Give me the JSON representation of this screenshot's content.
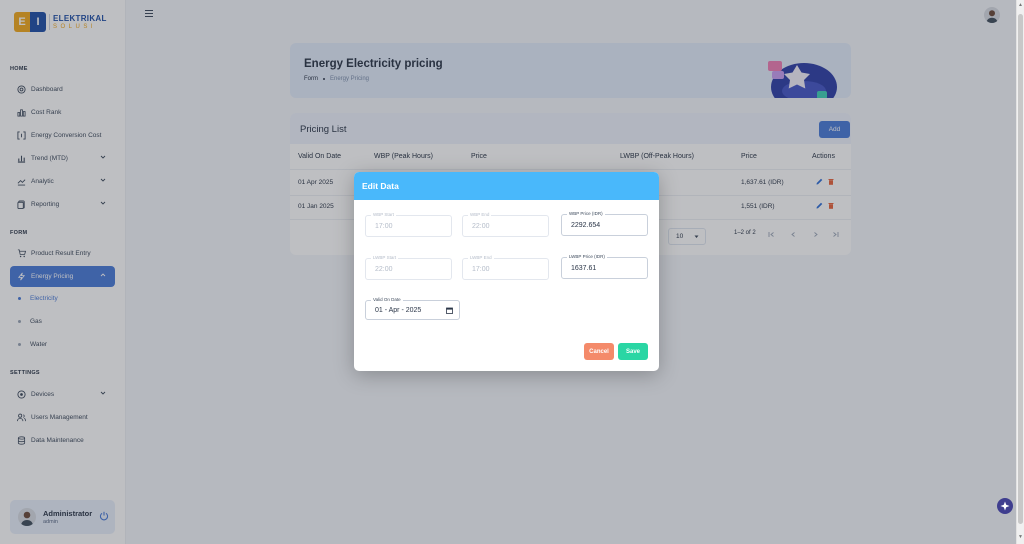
{
  "brand": {
    "line1": "ELEKTRIKAL",
    "line2": "SOLUSI",
    "mark_left": "E",
    "mark_right": "I"
  },
  "sidebar": {
    "sections": {
      "home": "HOME",
      "form": "FORM",
      "settings": "SETTINGS"
    },
    "items": {
      "dashboard": "Dashboard",
      "cost_rank": "Cost Rank",
      "energy_conversion_cost": "Energy Conversion Cost",
      "trend": "Trend (MTD)",
      "analytic": "Analytic",
      "reporting": "Reporting",
      "product_result_entry": "Product Result Entry",
      "energy_pricing": "Energy Pricing",
      "electricity": "Electricity",
      "gas": "Gas",
      "water": "Water",
      "devices": "Devices",
      "users_management": "Users Management",
      "data_maintenance": "Data Maintenance"
    }
  },
  "profile": {
    "name": "Administrator",
    "role": "admin"
  },
  "hero": {
    "title": "Energy Electricity pricing",
    "crumb_parent": "Form",
    "crumb_current": "Energy Pricing"
  },
  "pricing": {
    "title": "Pricing List",
    "add_label": "Add",
    "columns": {
      "valid_on": "Valid On Date",
      "wbp": "WBP (Peak Hours)",
      "price": "Price",
      "lwbp": "LWBP (Off-Peak Hours)",
      "price2": "Price",
      "actions": "Actions"
    },
    "rows": [
      {
        "valid_on": "01 Apr 2025",
        "lwbp_price": "1,637.61 (IDR)"
      },
      {
        "valid_on": "01 Jan 2025",
        "lwbp_price": "1,551 (IDR)"
      }
    ],
    "rows_per_page": "10",
    "range": "1–2 of 2"
  },
  "modal": {
    "title": "Edit Data",
    "wbp_start": {
      "label": "WBP Start",
      "value": "17:00"
    },
    "wbp_end": {
      "label": "WBP End",
      "value": "22:00"
    },
    "wbp_price": {
      "label": "WBP Price (IDR)",
      "value": "2292.654"
    },
    "lwbp_start": {
      "label": "LWBP Start",
      "value": "22:00"
    },
    "lwbp_end": {
      "label": "LWBP End",
      "value": "17:00"
    },
    "lwbp_price": {
      "label": "LWBP Price (IDR)",
      "value": "1637.61"
    },
    "valid_on": {
      "label": "Valid On Date",
      "value": "01 - Apr - 2025"
    },
    "cancel_label": "Cancel",
    "save_label": "Save"
  },
  "colors": {
    "primary": "#4a7bd8",
    "modal_header": "#49b8fb",
    "cancel": "#f48a6a",
    "save": "#2ad6a4",
    "brand_orange": "#f2a91e",
    "brand_blue": "#1f4fa8"
  }
}
